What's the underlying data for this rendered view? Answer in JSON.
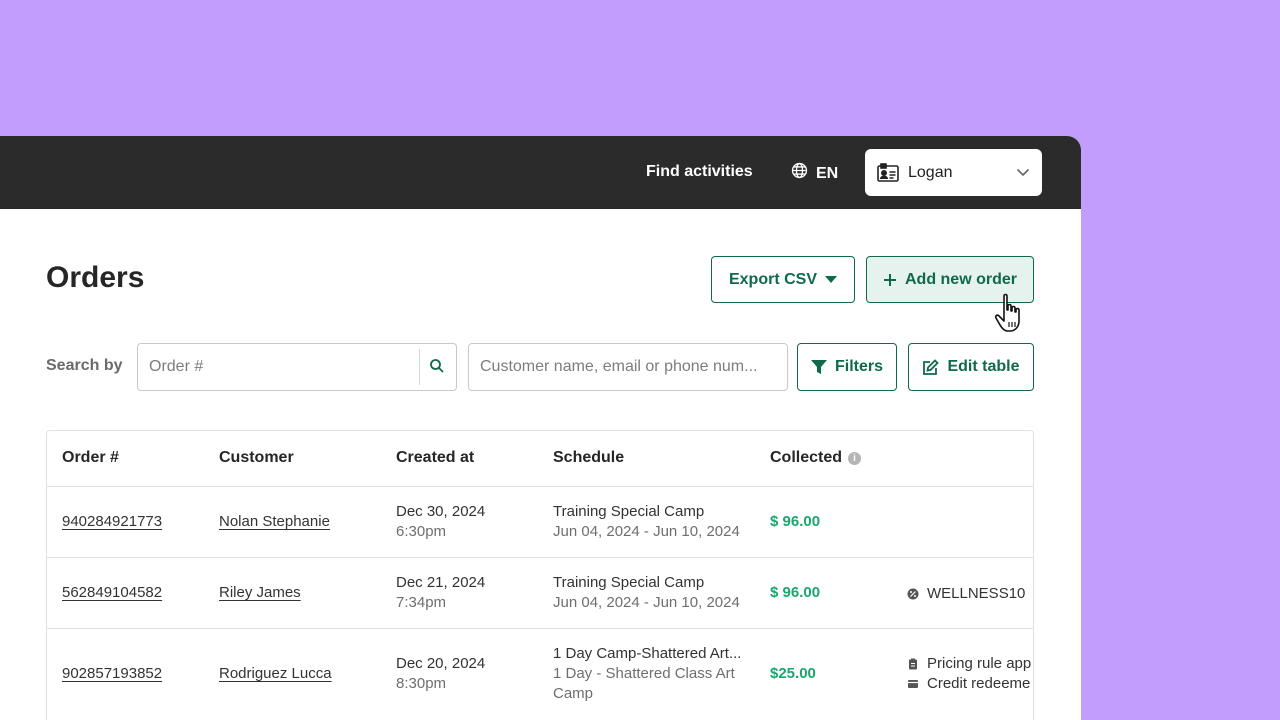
{
  "topbar": {
    "find_activities": "Find activities",
    "language": "EN",
    "user_name": "Logan"
  },
  "page": {
    "title": "Orders"
  },
  "actions": {
    "export_label": "Export CSV",
    "add_label": "Add new order",
    "filters_label": "Filters",
    "edit_table_label": "Edit table"
  },
  "search": {
    "label": "Search by",
    "order_placeholder": "Order #",
    "customer_placeholder": "Customer name, email or phone num..."
  },
  "table": {
    "columns": [
      "Order #",
      "Customer",
      "Created at",
      "Schedule",
      "Collected"
    ],
    "rows": [
      {
        "order": "940284921773",
        "customer": "Nolan Stephanie",
        "created_date": "Dec 30, 2024",
        "created_time": "6:30pm",
        "schedule_title": "Training Special Camp",
        "schedule_sub": "Jun 04, 2024 - Jun 10, 2024",
        "schedule_sub2": "",
        "collected": "$ 96.00",
        "extra": []
      },
      {
        "order": "562849104582",
        "customer": "Riley James",
        "created_date": "Dec 21, 2024",
        "created_time": "7:34pm",
        "schedule_title": "Training Special Camp",
        "schedule_sub": "Jun 04, 2024 - Jun 10, 2024",
        "schedule_sub2": "",
        "collected": "$ 96.00",
        "extra": [
          "WELLNESS10"
        ]
      },
      {
        "order": "902857193852",
        "customer": "Rodriguez Lucca",
        "created_date": "Dec 20, 2024",
        "created_time": "8:30pm",
        "schedule_title": "1 Day Camp-Shattered Art...",
        "schedule_sub": "1 Day - Shattered Class Art",
        "schedule_sub2": "Camp",
        "collected": "$25.00",
        "extra": [
          "Pricing rule app",
          "Credit redeeme"
        ]
      }
    ]
  },
  "colors": {
    "background": "#c39dfd",
    "topbar": "#2b2b2b",
    "accent": "#0f6a4b",
    "money": "#18a86d"
  },
  "icons": [
    "globe-icon",
    "id-card-icon",
    "chevron-down-icon",
    "caret-down-icon",
    "plus-icon",
    "search-icon",
    "filter-icon",
    "edit-icon",
    "info-icon",
    "discount-icon",
    "pricing-rule-icon",
    "credit-icon",
    "hand-cursor-icon"
  ]
}
